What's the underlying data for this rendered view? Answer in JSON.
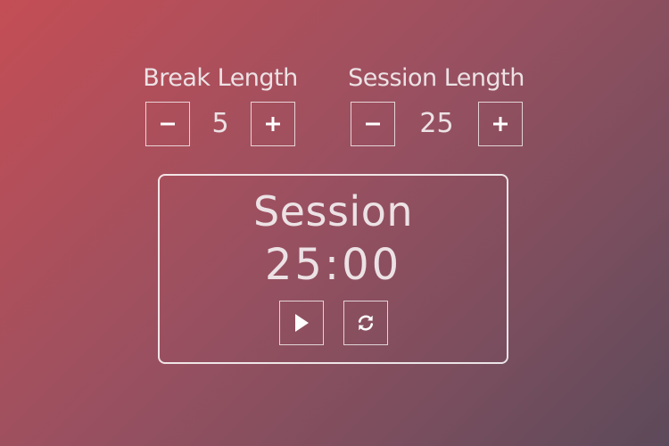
{
  "break": {
    "label": "Break Length",
    "value": "5",
    "decrement_icon": "minus-icon",
    "increment_icon": "plus-icon"
  },
  "session": {
    "label": "Session Length",
    "value": "25",
    "decrement_icon": "minus-icon",
    "increment_icon": "plus-icon"
  },
  "timer": {
    "label": "Session",
    "time": "25:00",
    "play_icon": "play-icon",
    "reset_icon": "refresh-icon"
  },
  "colors": {
    "background_start": "#c44e55",
    "background_end": "#5c4a5a",
    "foreground": "#ece2e5"
  }
}
